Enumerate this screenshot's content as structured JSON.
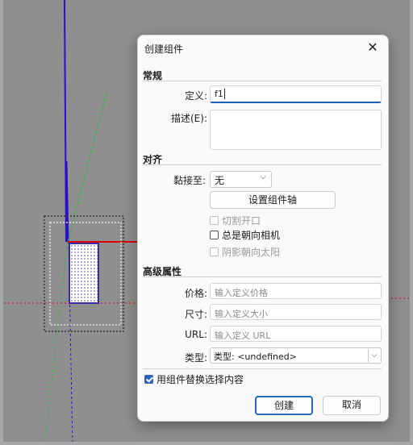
{
  "dialog": {
    "title": "创建组件",
    "close_icon": "close-icon"
  },
  "general": {
    "heading": "常规",
    "definition_label": "定义:",
    "definition_value": "f1",
    "description_label": "描述(E):",
    "description_value": ""
  },
  "align": {
    "heading": "对齐",
    "glue_label": "黏接至:",
    "glue_value": "无",
    "set_axes_button": "设置组件轴",
    "cut_opening": "切割开口",
    "always_face_camera": "总是朝向相机",
    "shadows_face_sun": "阴影朝向太阳"
  },
  "advanced": {
    "heading": "高级属性",
    "price_label": "价格:",
    "price_placeholder": "输入定义价格",
    "size_label": "尺寸:",
    "size_placeholder": "输入定义大小",
    "url_label": "URL:",
    "url_placeholder": "输入定义 URL",
    "type_label": "类型:",
    "type_value": "类型: <undefined>"
  },
  "replace_selection": "用组件替换选择内容",
  "buttons": {
    "create": "创建",
    "cancel": "取消"
  },
  "colors": {
    "accent": "#2468c4",
    "axis_red": "#d80000",
    "axis_blue": "#2a10c8",
    "axis_green": "#1fbf3b"
  }
}
